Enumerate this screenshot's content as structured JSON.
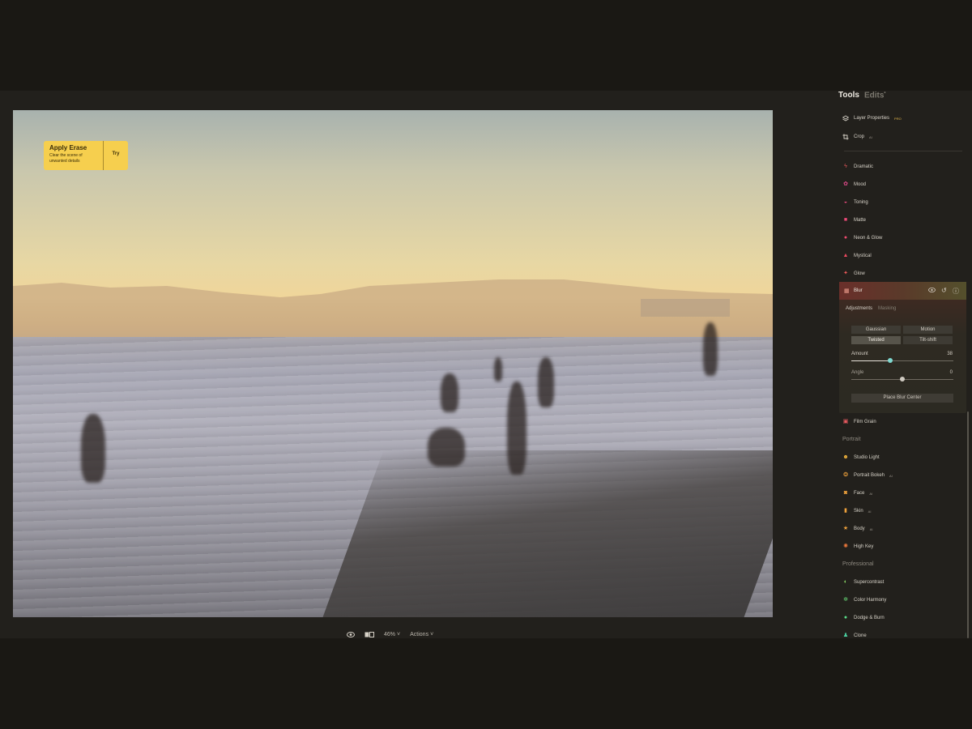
{
  "canvas": {
    "erase_card": {
      "title": "Apply Erase",
      "description": "Clear the scene of unwanted details",
      "action": "Try"
    }
  },
  "bottombar": {
    "zoom": "46%",
    "actions": "Actions"
  },
  "panel": {
    "tabs": {
      "tools": "Tools",
      "edits": "Edits",
      "edits_marker": "•"
    },
    "items": {
      "layer": {
        "label": "Layer Properties",
        "badge": "PRO"
      },
      "crop": {
        "label": "Crop",
        "badge": "AI"
      },
      "dramatic": "Dramatic",
      "mood": "Mood",
      "toning": "Toning",
      "matte": "Matte",
      "neon": "Neon & Glow",
      "mystical": "Mystical",
      "glow": "Glow",
      "film_grain": "Film Grain"
    },
    "blur": {
      "title": "Blur",
      "subtabs": {
        "adjustments": "Adjustments",
        "masking": "Masking"
      },
      "modes": [
        "Gaussian",
        "Motion",
        "Twisted",
        "Tilt-shift"
      ],
      "selected_mode": "Twisted",
      "amount": {
        "label": "Amount",
        "value": "38",
        "fraction": 0.38
      },
      "angle": {
        "label": "Angle",
        "value": "0",
        "fraction": 0.5
      },
      "place_button": "Place Blur Center"
    },
    "portrait": {
      "heading": "Portrait",
      "studio_light": "Studio Light",
      "portrait_bokeh": {
        "label": "Portrait Bokeh",
        "badge": "AI"
      },
      "face": {
        "label": "Face",
        "badge": "AI"
      },
      "skin": {
        "label": "Skin",
        "badge": "AI"
      },
      "body": {
        "label": "Body",
        "badge": "AI"
      },
      "high_key": "High Key"
    },
    "professional": {
      "heading": "Professional",
      "supercontrast": "Supercontrast",
      "color_harmony": "Color Harmony",
      "dodge_burn": "Dodge & Burn",
      "clone": "Clone"
    }
  },
  "colors": {
    "accent": "#f6cf4e",
    "panel_bg": "#22201c",
    "outer_bg": "#1a1814"
  }
}
